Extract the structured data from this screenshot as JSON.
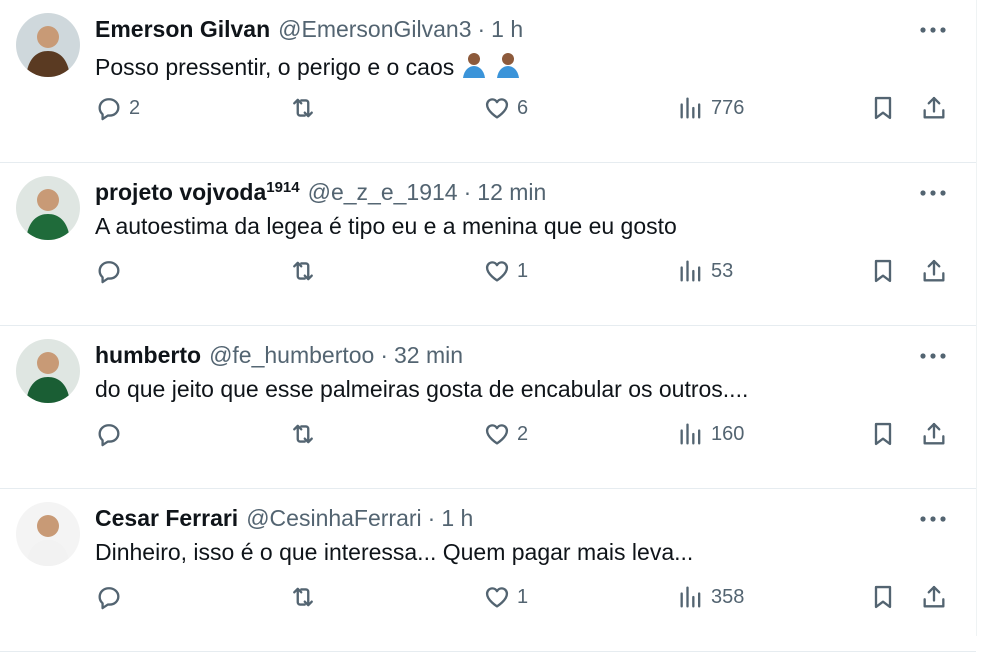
{
  "tweets": [
    {
      "name": "Emerson Gilvan",
      "name_sup": "",
      "handle": "@EmersonGilvan3",
      "time": "1 h",
      "text": "Posso pressentir, o perigo e o caos",
      "emojis": [
        "man-shrugging-emoji",
        "man-facepalming-emoji"
      ],
      "replies": "2",
      "retweets": "",
      "likes": "6",
      "views": "776",
      "avatar_color": "#5a3a22"
    },
    {
      "name": "projeto vojvoda",
      "name_sup": "1914",
      "handle": "@e_z_e_1914",
      "time": "12 min",
      "text": "A autoestima da legea é tipo eu e a menina que eu gosto",
      "emojis": [],
      "replies": "",
      "retweets": "",
      "likes": "1",
      "views": "53",
      "avatar_color": "#1f6b3a"
    },
    {
      "name": "humberto",
      "name_sup": "",
      "handle": "@fe_humbertoo",
      "time": "32 min",
      "text": "do que jeito que esse palmeiras gosta de encabular os outros....",
      "emojis": [],
      "replies": "",
      "retweets": "",
      "likes": "2",
      "views": "160",
      "avatar_color": "#1a5e34"
    },
    {
      "name": "Cesar Ferrari",
      "name_sup": "",
      "handle": "@CesinhaFerrari",
      "time": "1 h",
      "text": "Dinheiro, isso é o que interessa... Quem pagar mais leva...",
      "emojis": [],
      "replies": "",
      "retweets": "",
      "likes": "1",
      "views": "358",
      "avatar_color": "#f2f2f2"
    }
  ],
  "separator": "·",
  "colors": {
    "text": "#0f1419",
    "secondary": "#536471",
    "border": "#e6ecf0"
  }
}
